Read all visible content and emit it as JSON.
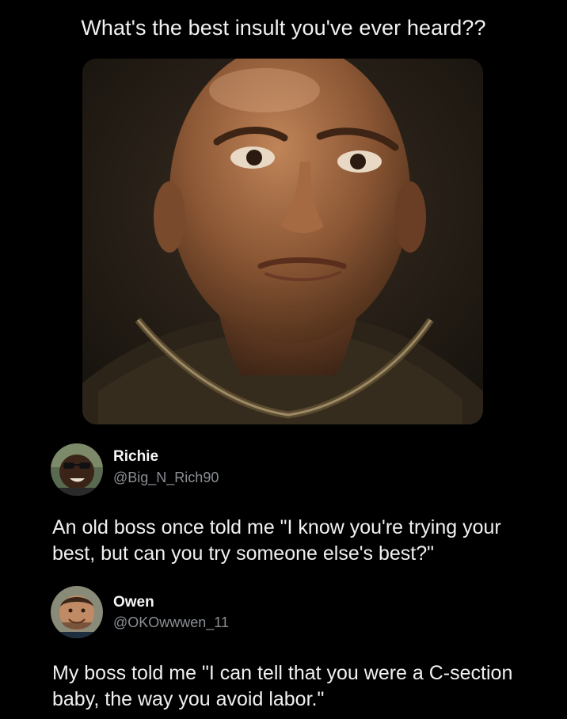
{
  "post": {
    "title": "What's the best insult you've ever heard??"
  },
  "media": {
    "subject": "close-up portrait of a bald man with a skeptical expression"
  },
  "tweets": [
    {
      "name": "Richie",
      "handle": "@Big_N_Rich90",
      "text": "An old boss once told me \"I know you're trying your best, but can you try someone else's best?\""
    },
    {
      "name": "Owen",
      "handle": "@OKOwwwen_11",
      "text": "My boss told me \"I can tell that you were a C-section baby, the way you avoid labor.\""
    }
  ],
  "colors": {
    "background": "#000000",
    "text": "#f0f0f0",
    "handle": "#8b8f94"
  }
}
